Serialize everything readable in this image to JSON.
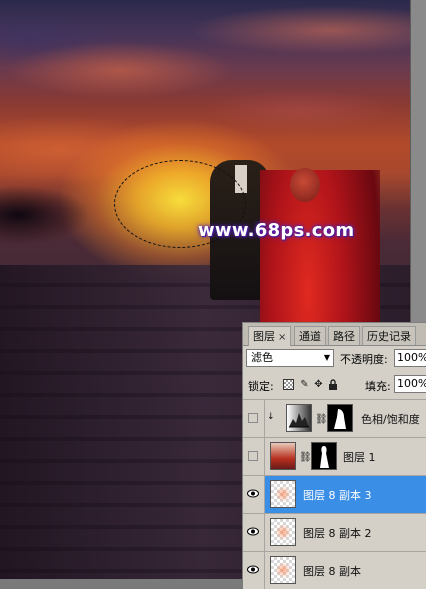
{
  "watermark": "www.68ps.com",
  "panel": {
    "tabs": [
      "图层",
      "通道",
      "路径",
      "历史记录"
    ],
    "tab_close": "×",
    "blend_mode": "滤色",
    "opacity_label": "不透明度:",
    "opacity_value": "100%",
    "lock_label": "锁定:",
    "fill_label": "填充:",
    "fill_value": "100%",
    "layers": [
      {
        "name": "色相/饱和度",
        "visible": false,
        "selected": false
      },
      {
        "name": "图层 1",
        "visible": false,
        "selected": false
      },
      {
        "name": "图层 8 副本 3",
        "visible": true,
        "selected": true
      },
      {
        "name": "图层 8 副本 2",
        "visible": true,
        "selected": false
      },
      {
        "name": "图层 8 副本",
        "visible": true,
        "selected": false
      }
    ]
  },
  "colors": {
    "selection_highlight": "#3a8ee6",
    "panel_bg": "#d4d0c8"
  }
}
